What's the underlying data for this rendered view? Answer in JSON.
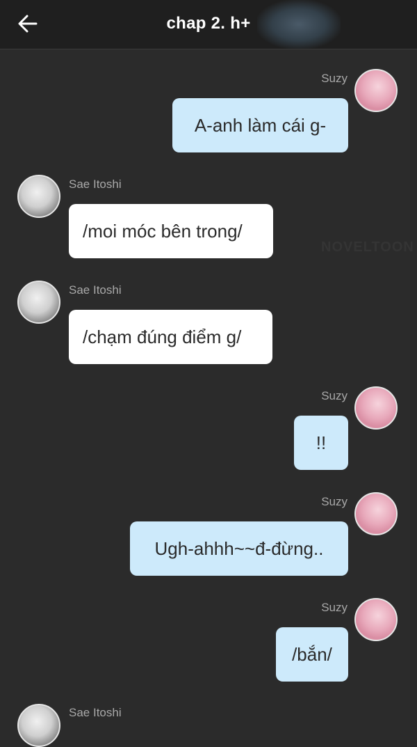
{
  "header": {
    "back_icon": "arrow-left-icon",
    "title": "chap 2. h+"
  },
  "watermark": "NOVELTOON",
  "colors": {
    "background": "#2b2b2b",
    "header": "#1f1f1f",
    "outgoing_bubble": "#cdeafb",
    "incoming_bubble": "#ffffff",
    "name_text": "#a9a9a9"
  },
  "messages": [
    {
      "sender": "Suzy",
      "side": "right",
      "text": "A-anh làm cái g-"
    },
    {
      "sender": "Sae Itoshi",
      "side": "left",
      "text": "/moi móc bên trong/"
    },
    {
      "sender": "Sae Itoshi",
      "side": "left",
      "text": "/chạm đúng điểm g/"
    },
    {
      "sender": "Suzy",
      "side": "right",
      "text": "!!"
    },
    {
      "sender": "Suzy",
      "side": "right",
      "text": "Ugh-ahhh~~đ-đừng.."
    },
    {
      "sender": "Suzy",
      "side": "right",
      "text": "/bắn/"
    },
    {
      "sender": "Sae Itoshi",
      "side": "left",
      "text": ""
    }
  ]
}
